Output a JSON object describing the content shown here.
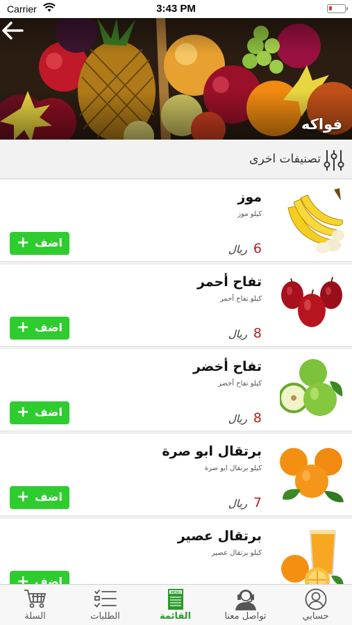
{
  "status_bar": {
    "carrier": "Carrier",
    "time": "3:43 PM",
    "battery_color": "#e53935"
  },
  "header": {
    "back_icon": "arrow-left-icon",
    "title": "فواكه"
  },
  "other_categories": {
    "label": "تصنيفات اخرى",
    "icon": "sliders-icon"
  },
  "products": [
    {
      "name": "موز",
      "unit": "كيلو موز",
      "price": "6",
      "currency": "ريال",
      "add_label": "اضف",
      "image": "bananas"
    },
    {
      "name": "تفاح أحمر",
      "unit": "كيلو تفاح أحمر",
      "price": "8",
      "currency": "ريال",
      "add_label": "اضف",
      "image": "red-apples"
    },
    {
      "name": "تفاح أخضر",
      "unit": "كيلو تفاح أخضر",
      "price": "8",
      "currency": "ريال",
      "add_label": "اضف",
      "image": "green-apples"
    },
    {
      "name": "برتقال ابو صرة",
      "unit": "كيلو برتقال ابو صرة",
      "price": "7",
      "currency": "ريال",
      "add_label": "اضف",
      "image": "oranges"
    },
    {
      "name": "برتقال عصير",
      "unit": "كيلو برتقال عصير",
      "price": "",
      "currency": "",
      "add_label": "اضف",
      "image": "orange-juice"
    }
  ],
  "tab_bar": {
    "tabs": [
      {
        "label": "السلة",
        "icon": "cart-icon",
        "active": false
      },
      {
        "label": "الطلبات",
        "icon": "checklist-icon",
        "active": false
      },
      {
        "label": "القائمة",
        "icon": "menu-book-icon",
        "active": true
      },
      {
        "label": "تواصل معنا",
        "icon": "support-agent-icon",
        "active": false
      },
      {
        "label": "حسابي",
        "icon": "account-icon",
        "active": false
      }
    ],
    "active_color": "#2a9a2a"
  },
  "colors": {
    "add_button": "#2ecc2e",
    "price": "#b22222"
  }
}
